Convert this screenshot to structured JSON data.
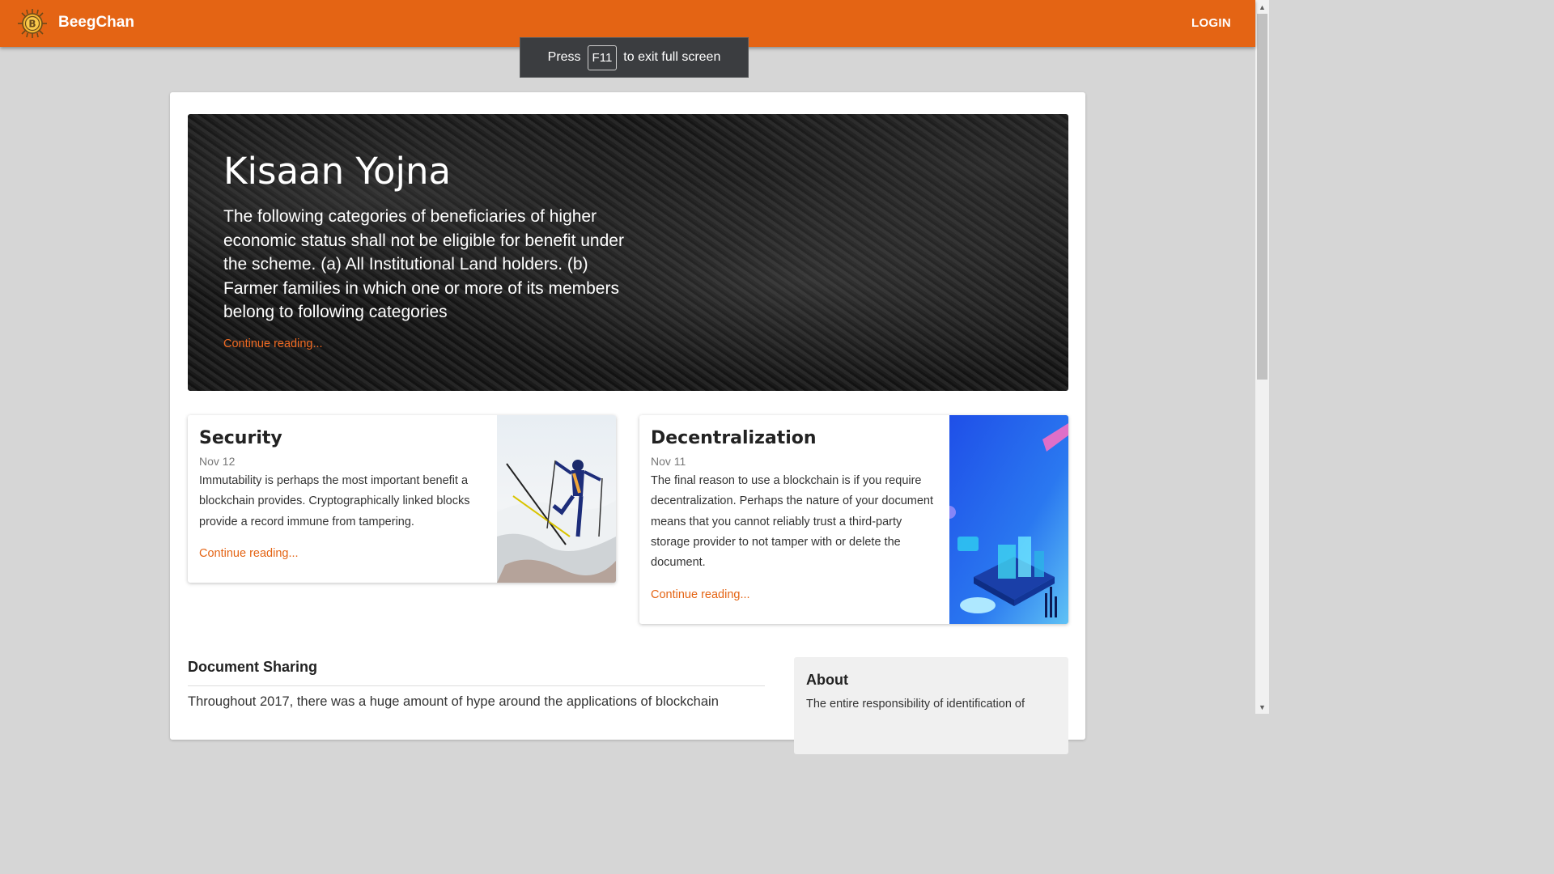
{
  "header": {
    "brand": "BeegChan",
    "login_label": "LOGIN",
    "accent": "#e46414"
  },
  "fullscreen_hint": {
    "before": "Press",
    "key": "F11",
    "after": "to exit full screen"
  },
  "hero": {
    "title": "Kisaan Yojna",
    "text": "The following categories of beneficiaries of higher economic status shall not be eligible for benefit under the scheme. (a) All Institutional Land holders. (b) Farmer families in which one or more of its members belong to following categories",
    "link": "Continue reading..."
  },
  "cards": [
    {
      "title": "Security",
      "date": "Nov 12",
      "text": "Immutability is perhaps the most important benefit a blockchain provides. Cryptographically linked blocks provide a record immune from tampering.",
      "link": "Continue reading..."
    },
    {
      "title": "Decentralization",
      "date": "Nov 11",
      "text": "The final reason to use a blockchain is if you require decentralization. Perhaps the nature of your document means that you cannot reliably trust a third-party storage provider to not tamper with or delete the document.",
      "link": "Continue reading..."
    }
  ],
  "main": {
    "section_title": "Document Sharing",
    "section_text": "Throughout 2017, there was a huge amount of hype around the applications of blockchain"
  },
  "sidebar": {
    "about_title": "About",
    "about_text": "The entire responsibility of identification of"
  }
}
